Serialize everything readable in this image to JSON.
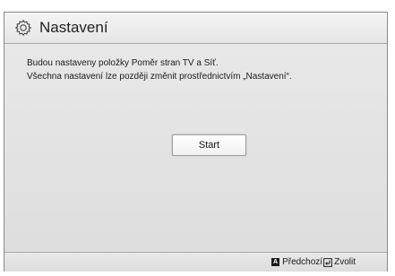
{
  "header": {
    "title": "Nastavení",
    "icon": "gear-icon"
  },
  "message": {
    "line1": "Budou nastaveny položky Poměr stran TV a Síť.",
    "line2": "Všechna nastavení lze později změnit prostřednictvím „Nastavení“."
  },
  "start_button": {
    "label": "Start"
  },
  "footer": {
    "key_a_label": "A",
    "previous_label": "Předchozí",
    "select_label": "Zvolit",
    "select_icon": "enter-icon"
  },
  "colors": {
    "background": "#e4e4e4",
    "header_bg": "#f0f0f0",
    "text": "#222222"
  }
}
